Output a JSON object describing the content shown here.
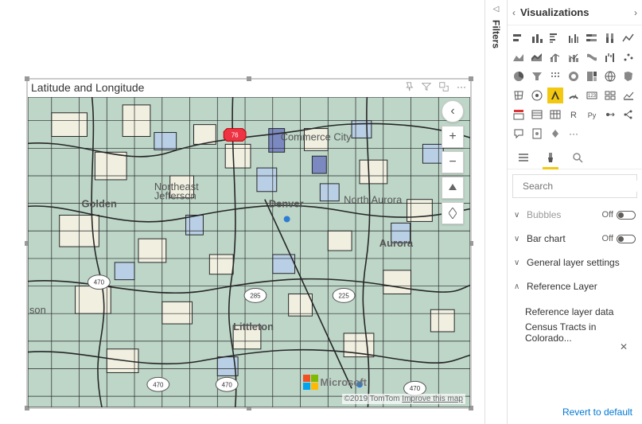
{
  "visual": {
    "title": "Latitude and Longitude",
    "attribution_prefix": "©2019 TomTom ",
    "attribution_link": "Improve this map",
    "logo_text": "Microsoft"
  },
  "map": {
    "cities": {
      "denver": "Denver",
      "golden": "Golden",
      "littleton": "Littleton",
      "aurora": "Aurora",
      "commerce_city": "Commerce City",
      "north_aurora": "North Aurora",
      "ne_jefferson": "Northeast\nJefferson",
      "json": "son"
    },
    "highways": [
      "470",
      "470",
      "470",
      "470",
      "285",
      "225",
      "76"
    ]
  },
  "panes": {
    "filters_label": "Filters",
    "viz_title": "Visualizations",
    "search_placeholder": "Search",
    "revert_label": "Revert to default"
  },
  "format": {
    "rows": [
      {
        "key": "bubbles",
        "label": "Bubbles",
        "toggle": "Off",
        "partial": true
      },
      {
        "key": "barchart",
        "label": "Bar chart",
        "toggle": "Off",
        "partial": false
      },
      {
        "key": "general",
        "label": "General layer settings",
        "partial": false
      },
      {
        "key": "reference",
        "label": "Reference Layer",
        "expanded": true,
        "partial": false
      }
    ],
    "reference_sub_label": "Reference layer data",
    "reference_sub_value": "Census Tracts in Colorado..."
  },
  "colors": {
    "tract_base": "#bdd6c8",
    "tract_light": "#f0efe0",
    "tract_blue": "#b8cfe5",
    "tract_dark": "#7b89c0",
    "stroke": "#262626",
    "road": "#d6d4c6"
  }
}
